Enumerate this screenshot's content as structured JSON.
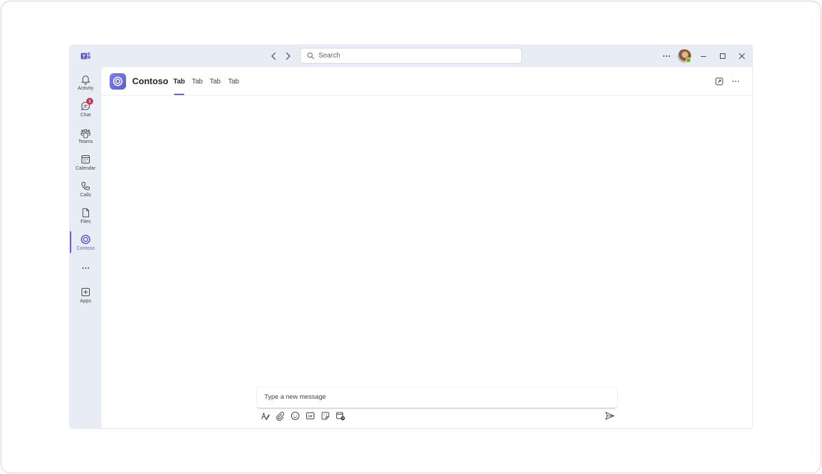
{
  "search": {
    "placeholder": "Search"
  },
  "rail": {
    "items": [
      {
        "label": "Activity",
        "icon": "bell-icon"
      },
      {
        "label": "Chat",
        "icon": "chat-icon",
        "badge": "1"
      },
      {
        "label": "Teams",
        "icon": "teams-icon"
      },
      {
        "label": "Calendar",
        "icon": "calendar-icon"
      },
      {
        "label": "Calls",
        "icon": "phone-icon"
      },
      {
        "label": "Files",
        "icon": "file-icon"
      },
      {
        "label": "Contoso",
        "icon": "contoso-app-icon",
        "active": true
      },
      {
        "label": "Apps",
        "icon": "add-apps-icon"
      }
    ]
  },
  "app": {
    "title": "Contoso",
    "tabs": [
      {
        "label": "Tab",
        "active": true
      },
      {
        "label": "Tab"
      },
      {
        "label": "Tab"
      },
      {
        "label": "Tab"
      }
    ]
  },
  "composer": {
    "placeholder": "Type a new message"
  },
  "colors": {
    "accent": "#5b5fc7",
    "badge": "#c4314b",
    "presence": "#6bb700",
    "rail_bg": "#e7ecf5"
  }
}
